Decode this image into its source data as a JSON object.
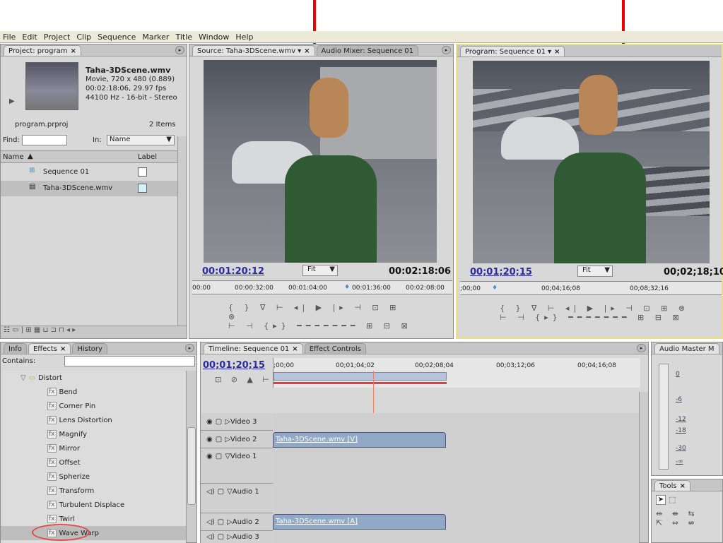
{
  "menu": [
    "File",
    "Edit",
    "Project",
    "Clip",
    "Sequence",
    "Marker",
    "Title",
    "Window",
    "Help"
  ],
  "project": {
    "tab": "Project: program",
    "clip_name": "Taha-3DScene.wmv",
    "clip_info1": "Movie, 720 x 480 (0.889)",
    "clip_info2": "00:02:18:06, 29.97 fps",
    "clip_info3": "44100 Hz - 16-bit - Stereo",
    "project_file": "program.prproj",
    "item_count": "2 Items",
    "find_label": "Find:",
    "in_label": "In:",
    "in_value": "Name",
    "col_name": "Name",
    "col_label": "Label",
    "items": [
      {
        "name": "Sequence 01",
        "label_color": "#ffffff"
      },
      {
        "name": "Taha-3DScene.wmv",
        "label_color": "#d4f0f8"
      }
    ]
  },
  "source": {
    "tab": "Source: Taha-3DScene.wmv",
    "tab2": "Audio Mixer: Sequence 01",
    "timecode": "00:01:20:12",
    "fit": "Fit",
    "duration": "00:02:18:06",
    "ruler": [
      "00:00",
      "00:00:32:00",
      "00:01:04:00",
      "00:01:36:00",
      "00:02:08:00"
    ]
  },
  "program": {
    "tab": "Program: Sequence 01",
    "timecode": "00;01;20;15",
    "fit": "Fit",
    "duration": "00;02;18;10",
    "ruler": [
      ";00;00",
      "00;04;16;08",
      "00;08;32;16"
    ]
  },
  "effects": {
    "tabs": [
      "Info",
      "Effects",
      "History"
    ],
    "contains_label": "Contains:",
    "folder": "Distort",
    "items": [
      "Bend",
      "Corner Pin",
      "Lens Distortion",
      "Magnify",
      "Mirror",
      "Offset",
      "Spherize",
      "Transform",
      "Turbulent Displace",
      "Twirl",
      "Wave Warp"
    ]
  },
  "timeline": {
    "tab": "Timeline: Sequence 01",
    "tab2": "Effect Controls",
    "timecode": "00;01;20;15",
    "ruler": [
      ";00;00",
      "00;01;04;02",
      "00;02;08;04",
      "00;03;12;06",
      "00;04;16;08"
    ],
    "tracks": [
      "Video 3",
      "Video 2",
      "Video 1",
      "Audio 1",
      "Audio 2",
      "Audio 3"
    ],
    "clip_video": "Taha-3DScene.wmv [V]",
    "clip_audio": "Taha-3DScene.wmv [A]"
  },
  "audio_master": {
    "tab": "Audio Master M",
    "labels": [
      "0",
      "-6",
      "-12",
      "-18",
      "-30",
      "-∞"
    ]
  },
  "tools": {
    "tab": "Tools"
  },
  "colors": {
    "annotation_red": "#e00000",
    "timecode_blue": "#2a2aa8",
    "panel_bg": "#d8d8d8",
    "highlight": "#f0e07a"
  },
  "icons": [
    "close-icon",
    "panel-menu-icon",
    "play-icon",
    "folder-icon",
    "sequence-icon",
    "clip-icon",
    "effect-preset-icon",
    "eye-icon",
    "speaker-icon",
    "selection-tool-icon"
  ]
}
